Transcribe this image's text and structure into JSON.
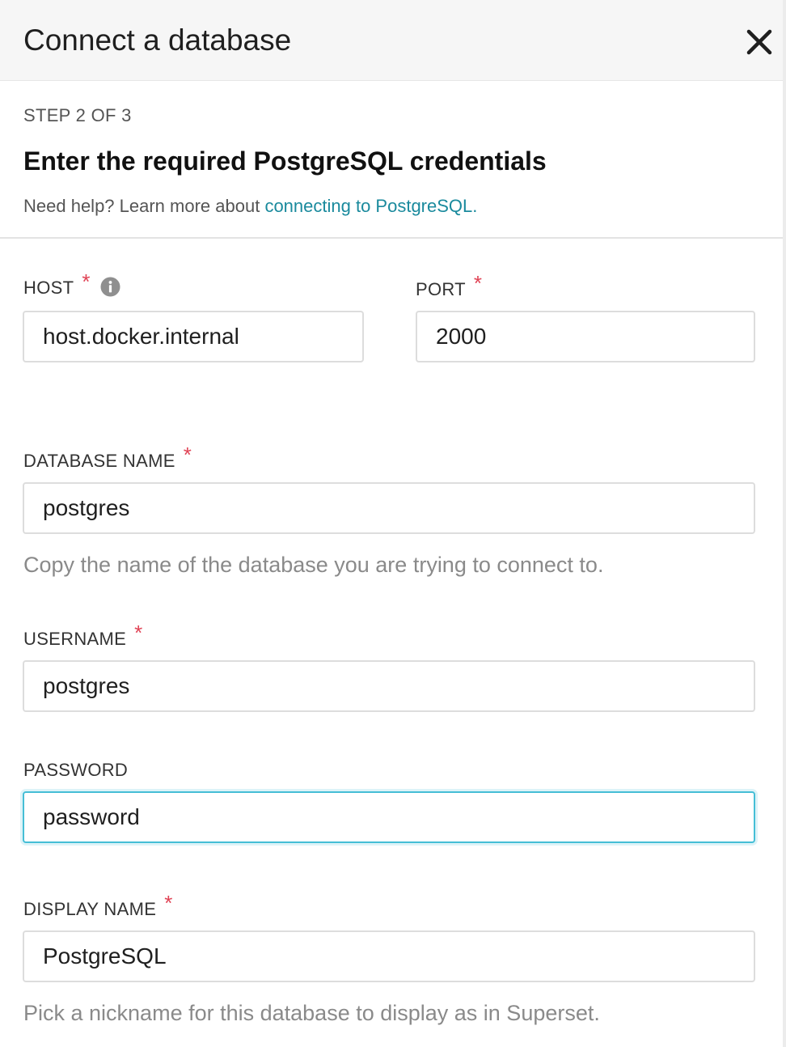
{
  "header": {
    "title": "Connect a database",
    "close_icon": "close-icon"
  },
  "step": {
    "label": "STEP 2 OF 3",
    "title": "Enter the required PostgreSQL credentials",
    "help_prefix": "Need help? Learn more about ",
    "help_link": "connecting to PostgreSQL."
  },
  "fields": {
    "host": {
      "label": "HOST",
      "required": "*",
      "value": "host.docker.internal",
      "info_icon": "info-icon"
    },
    "port": {
      "label": "PORT",
      "required": "*",
      "value": "2000"
    },
    "database_name": {
      "label": "DATABASE NAME",
      "required": "*",
      "value": "postgres",
      "helper": "Copy the name of the database you are trying to connect to."
    },
    "username": {
      "label": "USERNAME",
      "required": "*",
      "value": "postgres"
    },
    "password": {
      "label": "PASSWORD",
      "value": "password"
    },
    "display_name": {
      "label": "DISPLAY NAME",
      "required": "*",
      "value": "PostgreSQL",
      "helper": "Pick a nickname for this database to display as in Superset."
    }
  },
  "colors": {
    "accent_link": "#1a8a9d",
    "required": "#e04355",
    "focus_border": "#45bed6"
  }
}
